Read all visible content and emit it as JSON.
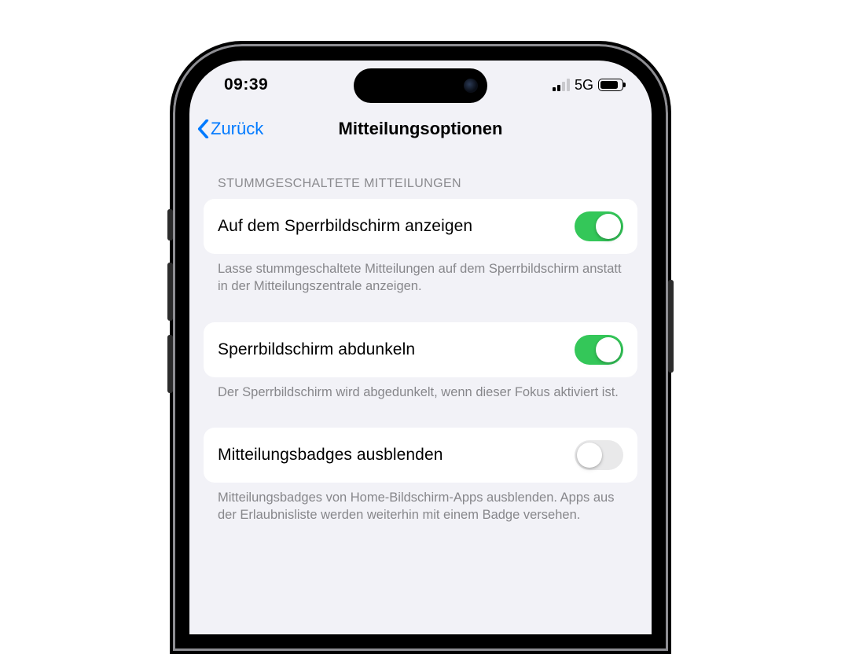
{
  "status": {
    "time": "09:39",
    "network_label": "5G",
    "signal_bars_active": 2,
    "battery_percent": 72
  },
  "nav": {
    "back_label": "Zurück",
    "title": "Mitteilungsoptionen"
  },
  "section": {
    "header": "STUMMGESCHALTETE MITTEILUNGEN",
    "rows": [
      {
        "label": "Auf dem Sperrbildschirm anzeigen",
        "on": true,
        "footer": "Lasse stummgeschaltete Mitteilungen auf dem Sperrbildschirm anstatt in der Mitteilungszentrale anzeigen."
      },
      {
        "label": "Sperrbildschirm abdunkeln",
        "on": true,
        "footer": "Der Sperrbildschirm wird abgedunkelt, wenn dieser Fokus aktiviert ist."
      },
      {
        "label": "Mitteilungsbadges ausblenden",
        "on": false,
        "footer": "Mitteilungsbadges von Home-Bildschirm-Apps ausblenden. Apps aus der Erlaubnisliste werden weiterhin mit einem Badge versehen."
      }
    ]
  }
}
